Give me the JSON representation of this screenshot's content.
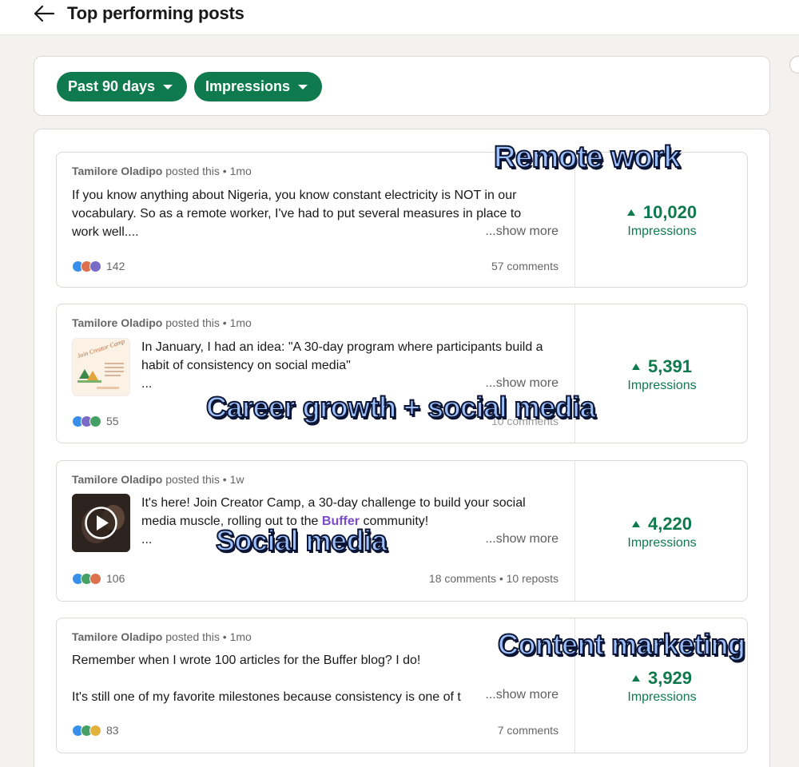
{
  "header": {
    "title": "Top performing posts",
    "back_icon": "arrow-left-icon"
  },
  "filters": {
    "period_label": "Past 90 days",
    "metric_label": "Impressions"
  },
  "posts": [
    {
      "author": "Tamilore Oladipo",
      "posted_text": " posted this • 1mo",
      "text_lines": [
        "If you know anything about Nigeria, you know constant electricity is NOT in our",
        "vocabulary. So as a remote worker, I've had to put several measures in place to",
        "work well...."
      ],
      "show_more": "...show more",
      "reaction_count": "142",
      "comments": "57 comments",
      "impressions": "10,020",
      "impressions_label": "Impressions"
    },
    {
      "author": "Tamilore Oladipo",
      "posted_text": " posted this • 1mo",
      "text_lines": [
        "In January, I had an idea: \"A 30-day program where participants build a",
        "habit of consistency on social media\"",
        "..."
      ],
      "thumb_text": "Join Creator Camp",
      "show_more": "...show more",
      "reaction_count": "55",
      "comments": "10 comments",
      "impressions": "5,391",
      "impressions_label": "Impressions"
    },
    {
      "author": "Tamilore Oladipo",
      "posted_text": " posted this • 1w",
      "text_line1": "It's here! Join Creator Camp, a 30-day challenge to build your social",
      "text_line2_before": "media muscle, rolling out to the ",
      "text_line2_link": "Buffer",
      "text_line2_after": " community!",
      "text_line3": "...",
      "show_more": "...show more",
      "reaction_count": "106",
      "comments": "18 comments • 10 reposts",
      "impressions": "4,220",
      "impressions_label": "Impressions"
    },
    {
      "author": "Tamilore Oladipo",
      "posted_text": " posted this • 1mo",
      "text_lines": [
        "Remember when I wrote 100 articles for the Buffer blog? I do!",
        "It's still one of my favorite milestones because consistency is one of t"
      ],
      "show_more": "...show more",
      "reaction_count": "83",
      "comments": "7 comments",
      "impressions": "3,929",
      "impressions_label": "Impressions"
    }
  ],
  "annotations": {
    "remote_work": "Remote work",
    "career_growth": "Career growth + social media",
    "social_media": "Social media",
    "content_marketing": "Content marketing"
  },
  "colors": {
    "accent_green": "#0e7a4e",
    "overlay_fill": "#9fc2ff",
    "overlay_outline": "#0c1533",
    "link_purple": "#7a4bc8"
  }
}
